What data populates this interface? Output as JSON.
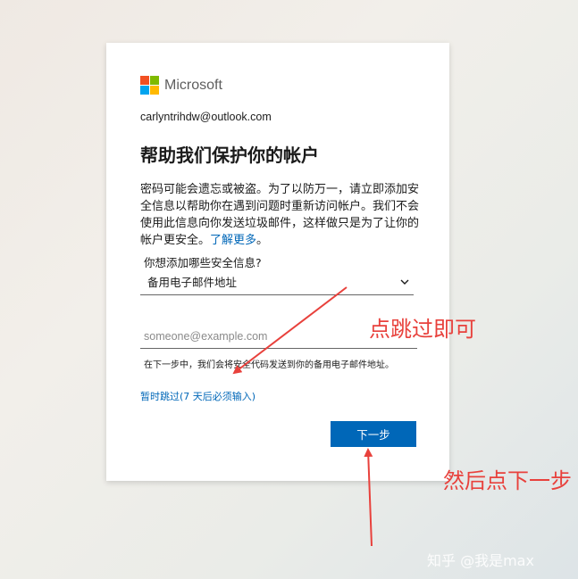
{
  "brand": {
    "name": "Microsoft",
    "logo_colors": [
      "#f25022",
      "#7fba00",
      "#00a4ef",
      "#ffb900"
    ]
  },
  "account": {
    "email": "carlyntrihdw@outlook.com"
  },
  "title": "帮助我们保护你的帐户",
  "description": {
    "text": "密码可能会遗忘或被盗。为了以防万一，请立即添加安全信息以帮助你在遇到问题时重新访问帐户。我们不会使用此信息向你发送垃圾邮件，这样做只是为了让你的帐户更安全。",
    "link": "了解更多",
    "suffix": "。"
  },
  "security_question": "你想添加哪些安全信息?",
  "security_select": {
    "selected": "备用电子邮件地址",
    "icon": "chevron-down-icon"
  },
  "email_input": {
    "value": "",
    "placeholder": "someone@example.com"
  },
  "hint": "在下一步中，我们会将安全代码发送到你的备用电子邮件地址。",
  "skip_link": "暂时跳过(7 天后必须输入)",
  "next_button": "下一步",
  "annotations": {
    "skip_note": "点跳过即可",
    "next_note": "然后点下一步",
    "color": "#e8413c"
  },
  "watermark": "知乎 @我是max",
  "colors": {
    "accent": "#0067b8"
  }
}
